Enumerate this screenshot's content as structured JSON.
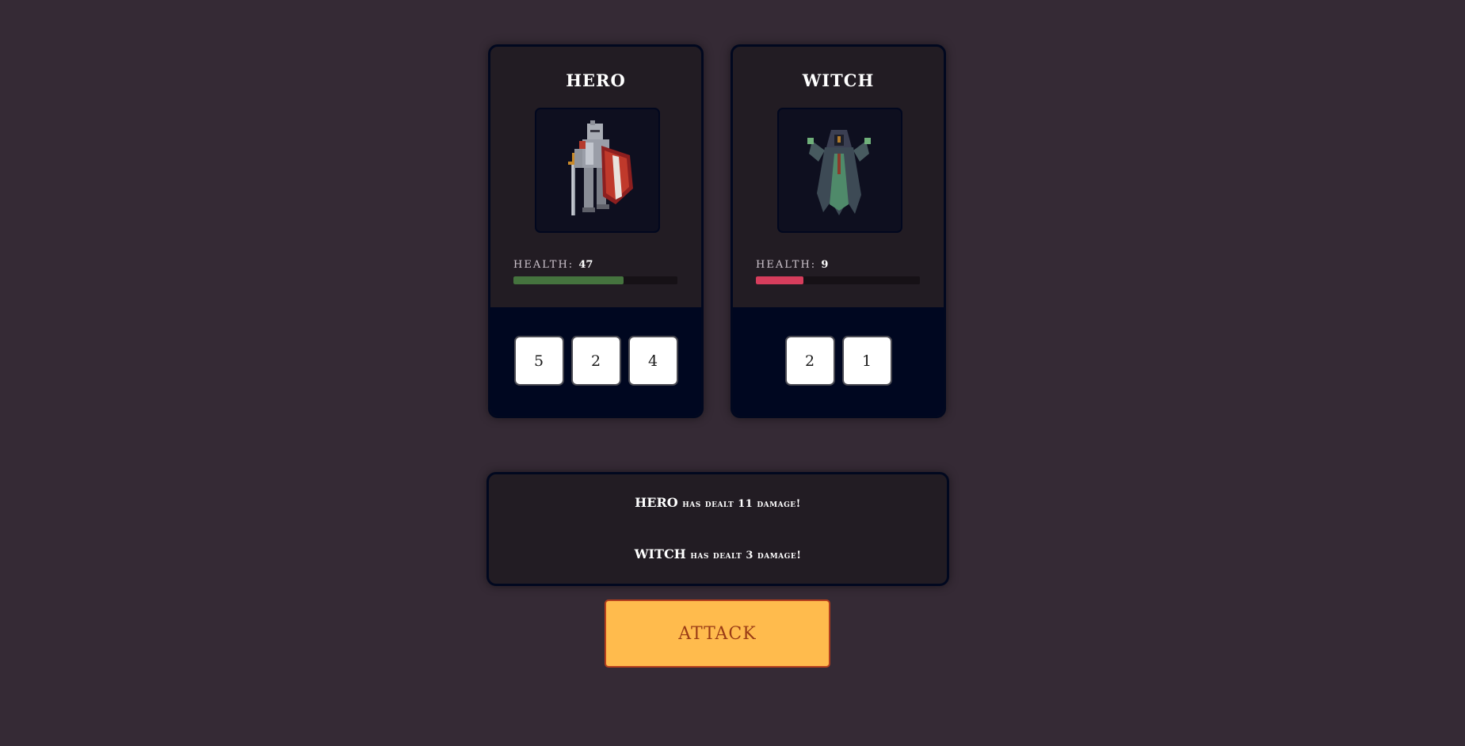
{
  "hero": {
    "name": "HERO",
    "health_label": "HEALTH:",
    "health": "47",
    "health_fraction": 0.67,
    "bar_color": "#45733e",
    "dice": [
      "5",
      "2",
      "4"
    ],
    "portrait_icon": "armored-knight-with-shield"
  },
  "witch": {
    "name": "WITCH",
    "health_label": "HEALTH:",
    "health": "9",
    "health_fraction": 0.29,
    "bar_color": "#d63d5c",
    "dice": [
      "2",
      "1"
    ],
    "portrait_icon": "hooded-green-witch"
  },
  "log": {
    "line1_name": "HERO",
    "line1_text": "has dealt 11 damage!",
    "line2_name": "WITCH",
    "line2_text": "has dealt 3 damage!"
  },
  "attack_label": "ATTACK"
}
